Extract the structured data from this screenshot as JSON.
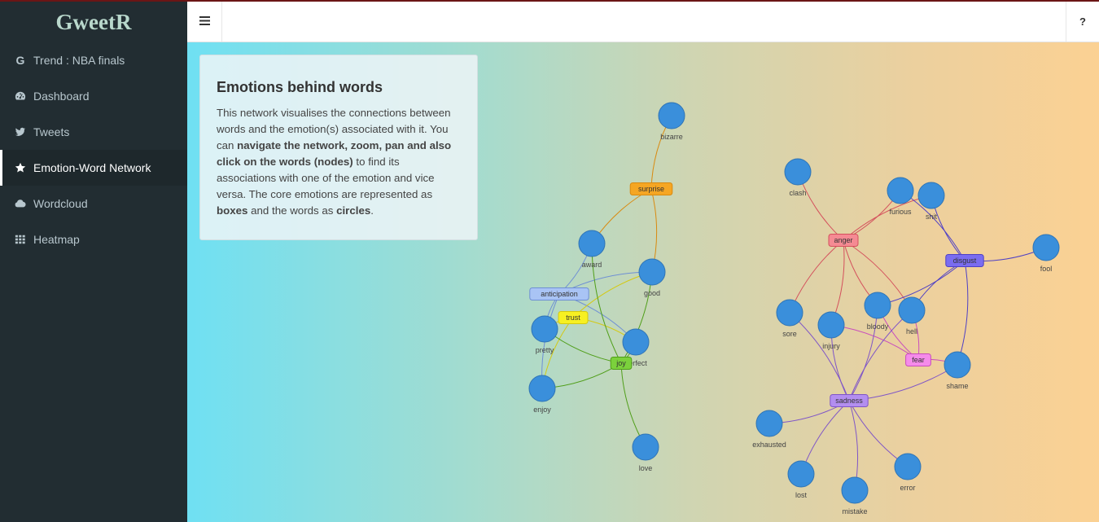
{
  "app": {
    "title": "GweetR"
  },
  "sidebar": {
    "items": [
      {
        "label": "Trend : NBA finals",
        "icon": "google-icon"
      },
      {
        "label": "Dashboard",
        "icon": "dashboard-icon"
      },
      {
        "label": "Tweets",
        "icon": "twitter-icon"
      },
      {
        "label": "Emotion-Word Network",
        "icon": "star-icon",
        "active": true
      },
      {
        "label": "Wordcloud",
        "icon": "cloud-icon"
      },
      {
        "label": "Heatmap",
        "icon": "grid-icon"
      }
    ]
  },
  "header": {
    "menu_icon": "≡",
    "help_label": "?"
  },
  "info": {
    "title": "Emotions behind words",
    "text1": "This network visualises the connections between words and the emotion(s) associated with it. You can ",
    "bold1": "navigate the network, zoom, pan and also click on the words (nodes)",
    "text2": " to find its associations with one of the emotion and vice versa. The core emotions are represented as ",
    "bold2": "boxes",
    "text3": " and the words as ",
    "bold3": "circles",
    "text4": "."
  },
  "network": {
    "emotions": [
      {
        "id": "surprise",
        "label": "surprise",
        "color": "#f5a623",
        "border": "#d98a10"
      },
      {
        "id": "anticipation",
        "label": "anticipation",
        "color": "#a9c4f5",
        "border": "#6e8fd4"
      },
      {
        "id": "trust",
        "label": "trust",
        "color": "#f7f022",
        "border": "#d4c910"
      },
      {
        "id": "joy",
        "label": "joy",
        "color": "#7bd13c",
        "border": "#4f9e18"
      },
      {
        "id": "anger",
        "label": "anger",
        "color": "#f58a93",
        "border": "#d4505c"
      },
      {
        "id": "disgust",
        "label": "disgust",
        "color": "#7a6cf0",
        "border": "#4f40c4"
      },
      {
        "id": "fear",
        "label": "fear",
        "color": "#f58bea",
        "border": "#c94dbd"
      },
      {
        "id": "sadness",
        "label": "sadness",
        "color": "#b38ef0",
        "border": "#7f55c7"
      }
    ],
    "words": [
      "bizarre",
      "award",
      "good",
      "pretty",
      "perfect",
      "enjoy",
      "love",
      "clash",
      "furious",
      "shit",
      "fool",
      "sore",
      "injury",
      "bloody",
      "hell",
      "shame",
      "exhausted",
      "lost",
      "mistake",
      "error"
    ],
    "edges": [
      [
        "surprise",
        "bizarre"
      ],
      [
        "surprise",
        "award"
      ],
      [
        "surprise",
        "good"
      ],
      [
        "anticipation",
        "award"
      ],
      [
        "anticipation",
        "good"
      ],
      [
        "anticipation",
        "pretty"
      ],
      [
        "anticipation",
        "perfect"
      ],
      [
        "anticipation",
        "enjoy"
      ],
      [
        "trust",
        "good"
      ],
      [
        "trust",
        "pretty"
      ],
      [
        "trust",
        "perfect"
      ],
      [
        "trust",
        "enjoy"
      ],
      [
        "joy",
        "award"
      ],
      [
        "joy",
        "good"
      ],
      [
        "joy",
        "pretty"
      ],
      [
        "joy",
        "perfect"
      ],
      [
        "joy",
        "enjoy"
      ],
      [
        "joy",
        "love"
      ],
      [
        "anger",
        "clash"
      ],
      [
        "anger",
        "furious"
      ],
      [
        "anger",
        "shit"
      ],
      [
        "anger",
        "sore"
      ],
      [
        "anger",
        "injury"
      ],
      [
        "anger",
        "bloody"
      ],
      [
        "anger",
        "hell"
      ],
      [
        "disgust",
        "furious"
      ],
      [
        "disgust",
        "shit"
      ],
      [
        "disgust",
        "fool"
      ],
      [
        "disgust",
        "bloody"
      ],
      [
        "disgust",
        "hell"
      ],
      [
        "disgust",
        "shame"
      ],
      [
        "fear",
        "injury"
      ],
      [
        "fear",
        "bloody"
      ],
      [
        "fear",
        "hell"
      ],
      [
        "fear",
        "shame"
      ],
      [
        "sadness",
        "sore"
      ],
      [
        "sadness",
        "injury"
      ],
      [
        "sadness",
        "bloody"
      ],
      [
        "sadness",
        "hell"
      ],
      [
        "sadness",
        "shame"
      ],
      [
        "sadness",
        "exhausted"
      ],
      [
        "sadness",
        "lost"
      ],
      [
        "sadness",
        "mistake"
      ],
      [
        "sadness",
        "error"
      ]
    ],
    "word_color": "#3a8fdb",
    "word_border": "#2f74b5"
  }
}
